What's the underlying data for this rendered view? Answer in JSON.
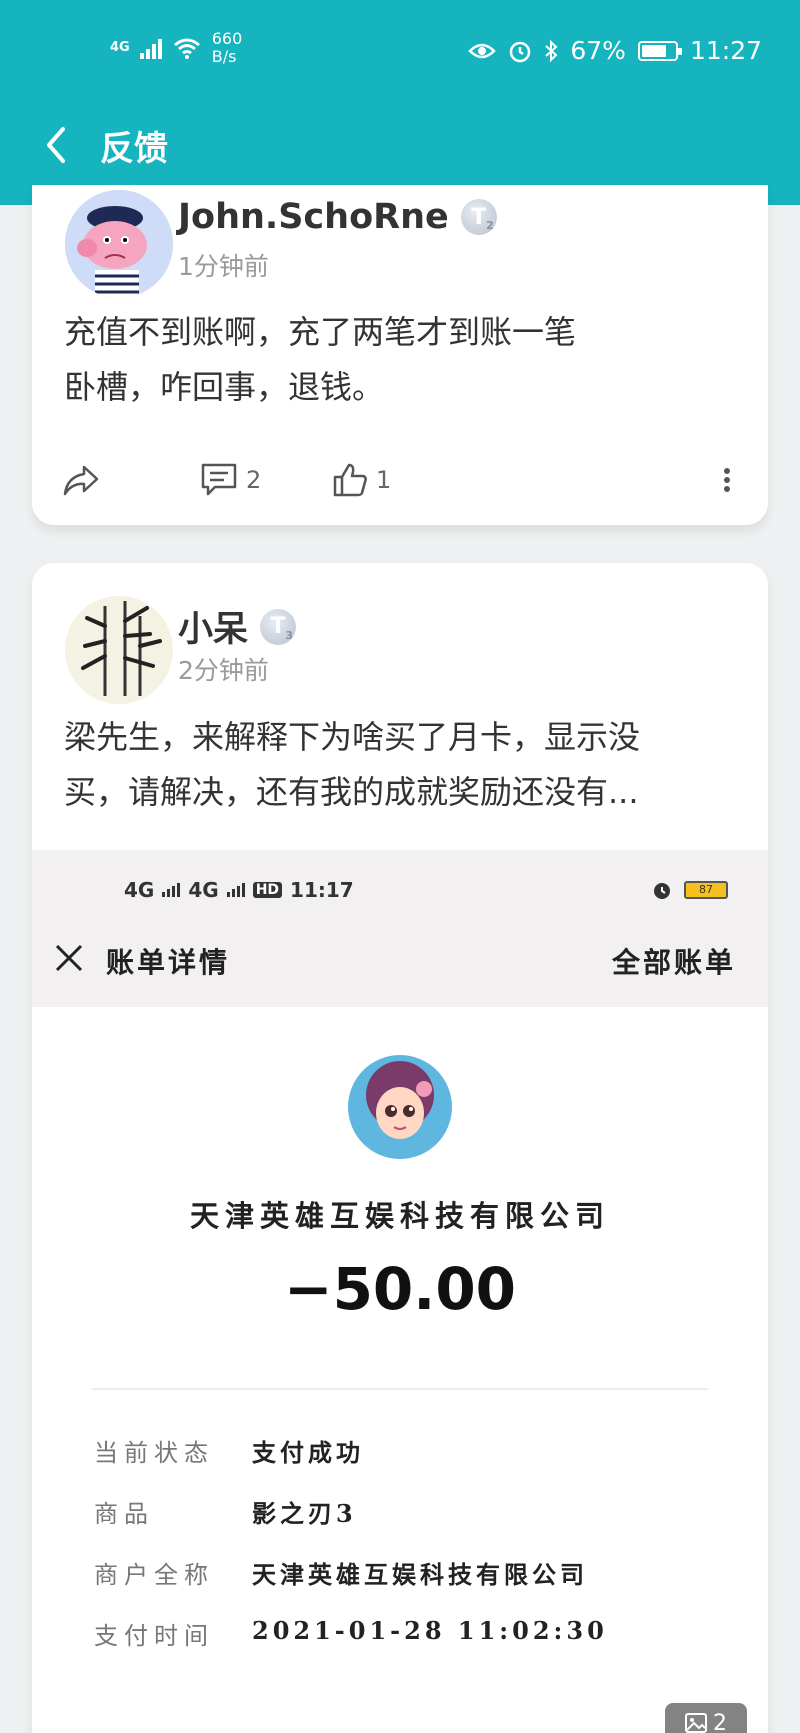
{
  "status_bar": {
    "network": "4G",
    "speed_value": "660",
    "speed_unit": "B/s",
    "battery": "67%",
    "time": "11:27"
  },
  "header": {
    "title": "反馈"
  },
  "posts": [
    {
      "user": "John.SchoRne",
      "level": "T",
      "level_num": "2",
      "time": "1分钟前",
      "text": [
        "充值不到账啊，充了两笔才到账一笔",
        "卧槽，咋回事，退钱。"
      ],
      "comments": "2",
      "likes": "1"
    },
    {
      "user": "小呆",
      "level": "T",
      "level_num": "3",
      "time": "2分钟前",
      "text": [
        "梁先生，来解释下为啥买了月卡，显示没",
        "买，请解决，还有我的成就奖励还没有..."
      ]
    }
  ],
  "screenshot": {
    "status_time": "11:17",
    "net1": "4G",
    "net2": "4G",
    "hd": "HD",
    "battery": "87",
    "title": "账单详情",
    "all_bills": "全部账单",
    "merchant": "天津英雄互娱科技有限公司",
    "amount": "−50.00",
    "rows": [
      {
        "key": "当前状态",
        "value": "支付成功"
      },
      {
        "key": "商品",
        "value": "影之刃3"
      },
      {
        "key": "商户全称",
        "value": "天津英雄互娱科技有限公司"
      },
      {
        "key": "支付时间",
        "value": "2021-01-28 11:02:30"
      }
    ]
  },
  "image_count": "2",
  "colors": {
    "header": "#16b4be",
    "accent_text": "#333333"
  }
}
